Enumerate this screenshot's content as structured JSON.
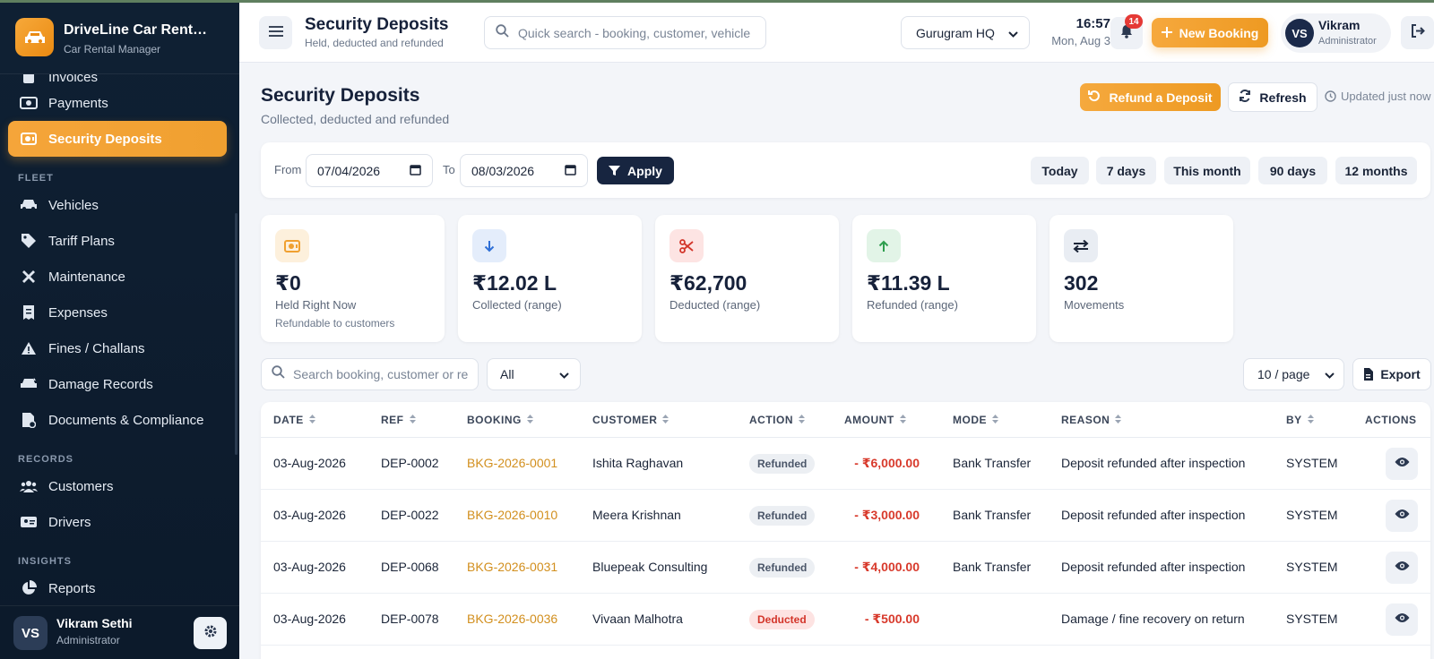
{
  "brand": {
    "title": "DriveLine Car Rent…",
    "subtitle": "Car Rental Manager"
  },
  "sidebar": {
    "items_top": [
      {
        "label": "Invoices",
        "icon": "invoice-icon"
      },
      {
        "label": "Payments",
        "icon": "payments-icon"
      },
      {
        "label": "Security Deposits",
        "icon": "deposit-icon",
        "active": true
      }
    ],
    "sections": [
      {
        "title": "FLEET",
        "items": [
          "Vehicles",
          "Tariff Plans",
          "Maintenance",
          "Expenses",
          "Fines / Challans",
          "Damage Records",
          "Documents & Compliance"
        ]
      },
      {
        "title": "RECORDS",
        "items": [
          "Customers",
          "Drivers"
        ]
      },
      {
        "title": "INSIGHTS",
        "items": [
          "Reports"
        ]
      }
    ],
    "user": {
      "initials": "VS",
      "name": "Vikram Sethi",
      "role": "Administrator"
    }
  },
  "header": {
    "title": "Security Deposits",
    "subtitle": "Held, deducted and refunded",
    "search_placeholder": "Quick search - booking, customer, vehicle",
    "branch": "Gurugram HQ",
    "time": "16:57",
    "date": "Mon, Aug 3",
    "notifications": "14",
    "new_booking": "New Booking",
    "user": {
      "initials": "VS",
      "name": "Vikram",
      "role": "Administrator"
    }
  },
  "page": {
    "title": "Security Deposits",
    "subtitle": "Collected, deducted and refunded",
    "refund_button": "Refund a Deposit",
    "refresh_button": "Refresh",
    "updated": "Updated just now"
  },
  "filters": {
    "from_label": "From",
    "from_value": "07/04/2026",
    "to_label": "To",
    "to_value": "08/03/2026",
    "apply": "Apply",
    "quick": [
      "Today",
      "7 days",
      "This month",
      "90 days",
      "12 months"
    ]
  },
  "stats": [
    {
      "value": "₹0",
      "label": "Held Right Now",
      "sub": "Refundable to customers",
      "icon": "deposit-icon",
      "color": "#f0a030"
    },
    {
      "value": "₹12.02 L",
      "label": "Collected (range)",
      "sub": "",
      "icon": "arrow-down-icon",
      "color": "#2f6fd6"
    },
    {
      "value": "₹62,700",
      "label": "Deducted (range)",
      "sub": "",
      "icon": "scissors-icon",
      "color": "#d3352a"
    },
    {
      "value": "₹11.39 L",
      "label": "Refunded (range)",
      "sub": "",
      "icon": "arrow-up-icon",
      "color": "#2e9e4e"
    },
    {
      "value": "302",
      "label": "Movements",
      "sub": "",
      "icon": "swap-icon",
      "color": "#1b2538"
    }
  ],
  "table_tools": {
    "search_placeholder": "Search booking, customer or ref",
    "filter_value": "All",
    "per_page": "10 / page",
    "export": "Export"
  },
  "table": {
    "columns": [
      "DATE",
      "REF",
      "BOOKING",
      "CUSTOMER",
      "ACTION",
      "AMOUNT",
      "MODE",
      "REASON",
      "BY",
      "ACTIONS"
    ],
    "rows": [
      {
        "date": "03-Aug-2026",
        "ref": "DEP-0002",
        "booking": "BKG-2026-0001",
        "customer": "Ishita Raghavan",
        "action": "Refunded",
        "amount": "- ₹6,000.00",
        "mode": "Bank Transfer",
        "reason": "Deposit refunded after inspection",
        "by": "SYSTEM"
      },
      {
        "date": "03-Aug-2026",
        "ref": "DEP-0022",
        "booking": "BKG-2026-0010",
        "customer": "Meera Krishnan",
        "action": "Refunded",
        "amount": "- ₹3,000.00",
        "mode": "Bank Transfer",
        "reason": "Deposit refunded after inspection",
        "by": "SYSTEM"
      },
      {
        "date": "03-Aug-2026",
        "ref": "DEP-0068",
        "booking": "BKG-2026-0031",
        "customer": "Bluepeak Consulting",
        "action": "Refunded",
        "amount": "- ₹4,000.00",
        "mode": "Bank Transfer",
        "reason": "Deposit refunded after inspection",
        "by": "SYSTEM"
      },
      {
        "date": "03-Aug-2026",
        "ref": "DEP-0078",
        "booking": "BKG-2026-0036",
        "customer": "Vivaan Malhotra",
        "action": "Deducted",
        "amount": "- ₹500.00",
        "mode": "",
        "reason": "Damage / fine recovery on return",
        "by": "SYSTEM"
      }
    ]
  }
}
